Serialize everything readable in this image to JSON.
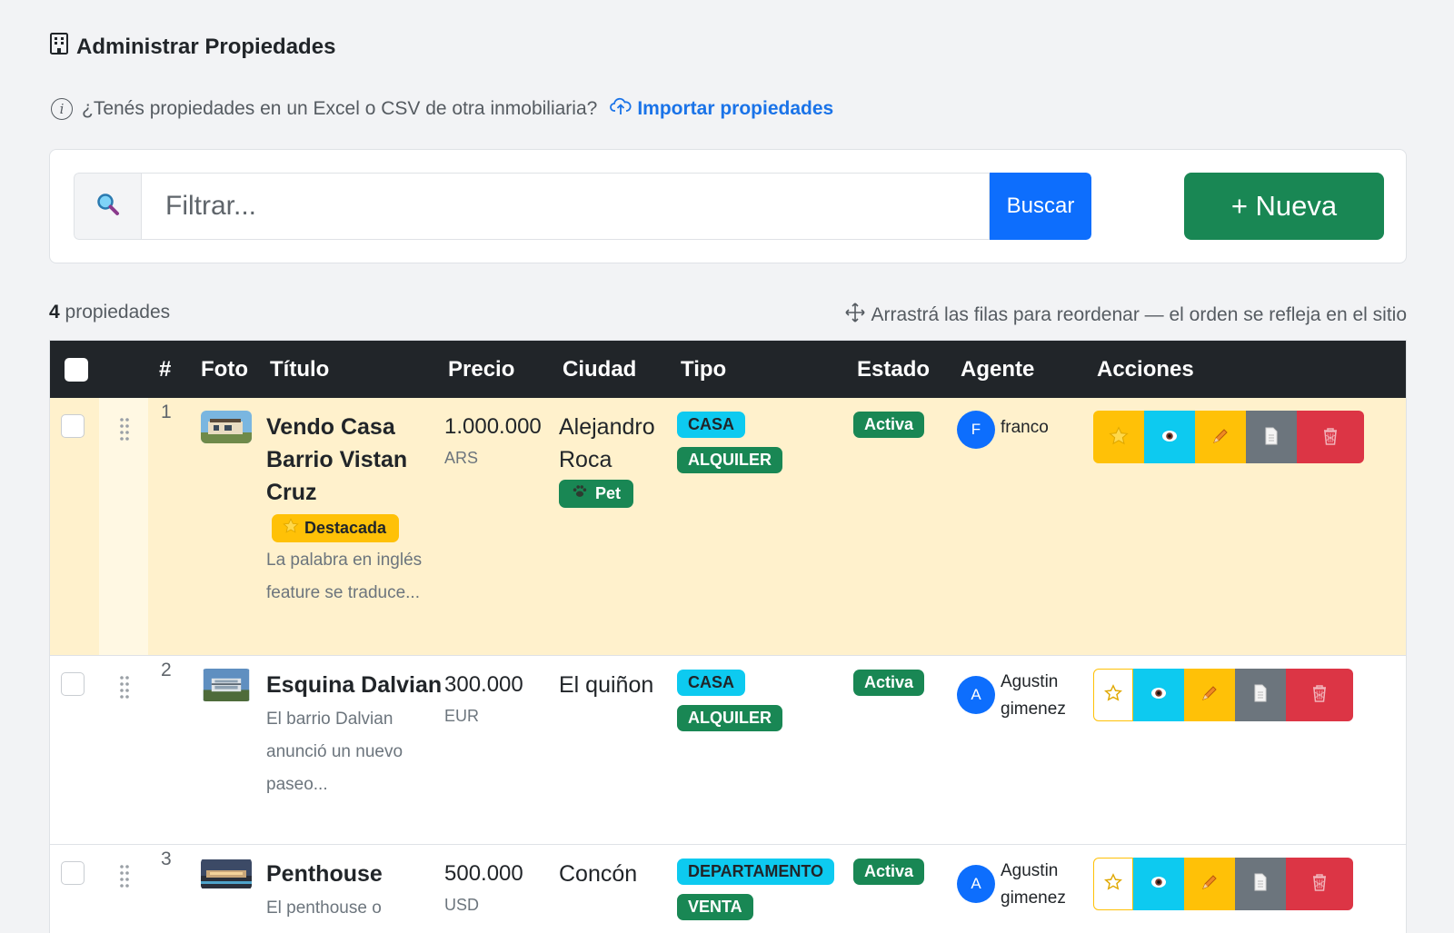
{
  "header": {
    "title": "Administrar Propiedades",
    "icon": "building-icon"
  },
  "import": {
    "question": "¿Tenés propiedades en un Excel o CSV de otra inmobiliaria?",
    "link_label": "Importar propiedades"
  },
  "search": {
    "placeholder": "Filtrar...",
    "button_label": "Buscar",
    "new_button_label": "+ Nueva"
  },
  "summary": {
    "count": "4",
    "count_label": "propiedades",
    "reorder_hint": "Arrastrá las filas para reordenar — el orden se refleja en el sitio"
  },
  "table": {
    "columns": [
      "#",
      "Foto",
      "Título",
      "Precio",
      "Ciudad",
      "Tipo",
      "Estado",
      "Agente",
      "Acciones"
    ],
    "rows": [
      {
        "num": "1",
        "title": "Vendo Casa Barrio Vistan Cruz",
        "featured_label": "Destacada",
        "description": "La palabra en inglés feature se traduce...",
        "price": "1.000.000",
        "currency": "ARS",
        "city": "Alejandro Roca",
        "pet_label": "Pet",
        "type": "CASA",
        "operation": "ALQUILER",
        "status": "Activa",
        "agent_initial": "F",
        "agent_name": "franco"
      },
      {
        "num": "2",
        "title": "Esquina Dalvian",
        "description": "El barrio Dalvian anunció un nuevo paseo...",
        "price": "300.000",
        "currency": "EUR",
        "city": "El quiñon",
        "type": "CASA",
        "operation": "ALQUILER",
        "status": "Activa",
        "agent_initial": "A",
        "agent_name": "Agustin gimenez"
      },
      {
        "num": "3",
        "title": "Penthouse",
        "description": "El penthouse o",
        "price": "500.000",
        "currency": "USD",
        "city": "Concón",
        "type": "DEPARTAMENTO",
        "operation": "VENTA",
        "status": "Activa",
        "agent_initial": "A",
        "agent_name": "Agustin gimenez"
      }
    ]
  },
  "colors": {
    "primary": "#0d6efd",
    "success": "#198754",
    "warning": "#ffc107",
    "info": "#0dcaf0",
    "danger": "#dc3545",
    "secondary": "#6c757d",
    "header_dark": "#212529",
    "featured_row": "#fff1cc"
  }
}
